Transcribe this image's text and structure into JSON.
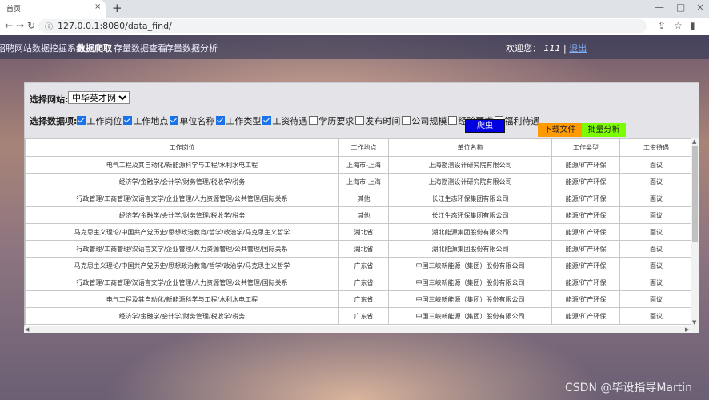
{
  "browser": {
    "tab_title": "首页",
    "url": "127.0.0.1:8080/data_find/",
    "new_tab": "+",
    "close": "×",
    "minimize": "—",
    "maximize": "□"
  },
  "topnav": {
    "items": [
      "招聘网站数据挖掘系统",
      "数据爬取",
      "存量数据查看",
      "存量数据分析"
    ],
    "welcome_label": "欢迎您：",
    "username": "111",
    "separator": "|",
    "logout": "退出"
  },
  "search": {
    "site_label": "选择网站:",
    "site_value": "中华英才网",
    "fields_label": "选择数据项:",
    "fields": [
      {
        "label": "工作岗位",
        "checked": true
      },
      {
        "label": "工作地点",
        "checked": true
      },
      {
        "label": "单位名称",
        "checked": true
      },
      {
        "label": "工作类型",
        "checked": true
      },
      {
        "label": "工资待遇",
        "checked": true
      },
      {
        "label": "学历要求",
        "checked": false
      },
      {
        "label": "发布时间",
        "checked": false
      },
      {
        "label": "公司规模",
        "checked": false
      },
      {
        "label": "经验要求",
        "checked": false
      },
      {
        "label": "福利待遇",
        "checked": false
      }
    ],
    "crawl_button": "爬虫"
  },
  "actions": {
    "download": "下载文件",
    "batch_analysis": "批量分析"
  },
  "table": {
    "columns": [
      "工作岗位",
      "工作地点",
      "单位名称",
      "工作类型",
      "工资待遇"
    ],
    "rows": [
      [
        "电气工程及其自动化/新能源科学与工程/水利水电工程",
        "上海市-上海",
        "上海勘测设计研究院有限公司",
        "能源/矿产环保",
        "面议"
      ],
      [
        "经济学/金融学/会计学/财务管理/税收学/税务",
        "上海市-上海",
        "上海勘测设计研究院有限公司",
        "能源/矿产环保",
        "面议"
      ],
      [
        "行政管理/工商管理/汉语言文学/企业管理/人力资源管理/公共管理/国际关系",
        "其他",
        "长江生态环保集团有限公司",
        "能源/矿产环保",
        "面议"
      ],
      [
        "经济学/金融学/会计学/财务管理/税收学/税务",
        "其他",
        "长江生态环保集团有限公司",
        "能源/矿产环保",
        "面议"
      ],
      [
        "马克思主义理论/中国共产党历史/思想政治教育/哲学/政治学/马克思主义哲学",
        "湖北省",
        "湖北能源集团股份有限公司",
        "能源/矿产环保",
        "面议"
      ],
      [
        "行政管理/工商管理/汉语言文学/企业管理/人力资源管理/公共管理/国际关系",
        "湖北省",
        "湖北能源集团股份有限公司",
        "能源/矿产环保",
        "面议"
      ],
      [
        "马克思主义理论/中国共产党历史/思想政治教育/哲学/政治学/马克思主义哲学",
        "广东省",
        "中国三峡新能源（集团）股份有限公司",
        "能源/矿产环保",
        "面议"
      ],
      [
        "行政管理/工商管理/汉语言文学/企业管理/人力资源管理/公共管理/国际关系",
        "广东省",
        "中国三峡新能源（集团）股份有限公司",
        "能源/矿产环保",
        "面议"
      ],
      [
        "电气工程及其自动化/新能源科学与工程/水利水电工程",
        "广东省",
        "中国三峡新能源（集团）股份有限公司",
        "能源/矿产环保",
        "面议"
      ],
      [
        "经济学/金融学/会计学/财务管理/税收学/税务",
        "广东省",
        "中国三峡新能源（集团）股份有限公司",
        "能源/矿产环保",
        "面议"
      ]
    ]
  },
  "watermark": "CSDN @毕设指导Martin"
}
